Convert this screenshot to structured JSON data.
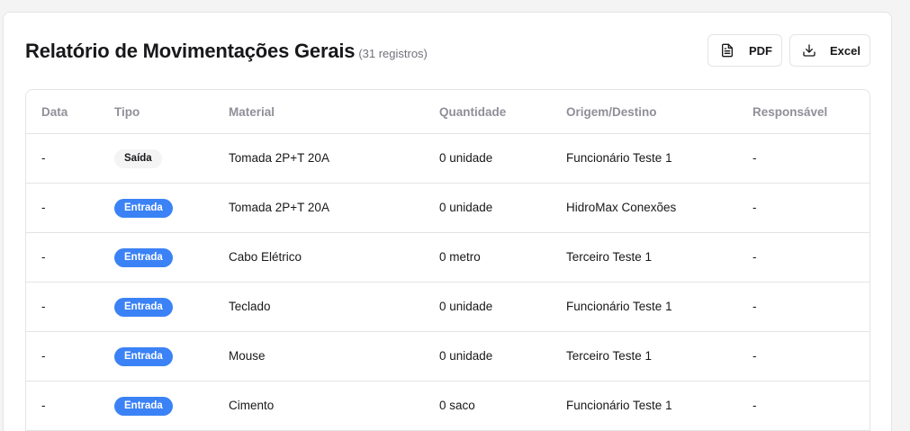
{
  "header": {
    "title": "Relatório de Movimentações Gerais",
    "count": "(31 registros)"
  },
  "actions": {
    "pdf_label": "PDF",
    "excel_label": "Excel"
  },
  "icons": {
    "pdf": "file-text-icon",
    "excel": "download-icon"
  },
  "colors": {
    "entrada_badge": "#3b82f6",
    "saida_badge": "#f4f4f5",
    "header_text": "#8f8f99"
  },
  "table": {
    "columns": [
      "Data",
      "Tipo",
      "Material",
      "Quantidade",
      "Origem/Destino",
      "Responsável"
    ],
    "rows": [
      {
        "data": "-",
        "tipo": "Saída",
        "tipo_kind": "saida",
        "material": "Tomada 2P+T 20A",
        "quantidade": "0 unidade",
        "origem": "Funcionário Teste 1",
        "responsavel": "-"
      },
      {
        "data": "-",
        "tipo": "Entrada",
        "tipo_kind": "entrada",
        "material": "Tomada 2P+T 20A",
        "quantidade": "0 unidade",
        "origem": "HidroMax Conexões",
        "responsavel": "-"
      },
      {
        "data": "-",
        "tipo": "Entrada",
        "tipo_kind": "entrada",
        "material": "Cabo Elétrico",
        "quantidade": "0 metro",
        "origem": "Terceiro Teste 1",
        "responsavel": "-"
      },
      {
        "data": "-",
        "tipo": "Entrada",
        "tipo_kind": "entrada",
        "material": "Teclado",
        "quantidade": "0 unidade",
        "origem": "Funcionário Teste 1",
        "responsavel": "-"
      },
      {
        "data": "-",
        "tipo": "Entrada",
        "tipo_kind": "entrada",
        "material": "Mouse",
        "quantidade": "0 unidade",
        "origem": "Terceiro Teste 1",
        "responsavel": "-"
      },
      {
        "data": "-",
        "tipo": "Entrada",
        "tipo_kind": "entrada",
        "material": "Cimento",
        "quantidade": "0 saco",
        "origem": "Funcionário Teste 1",
        "responsavel": "-"
      }
    ]
  }
}
